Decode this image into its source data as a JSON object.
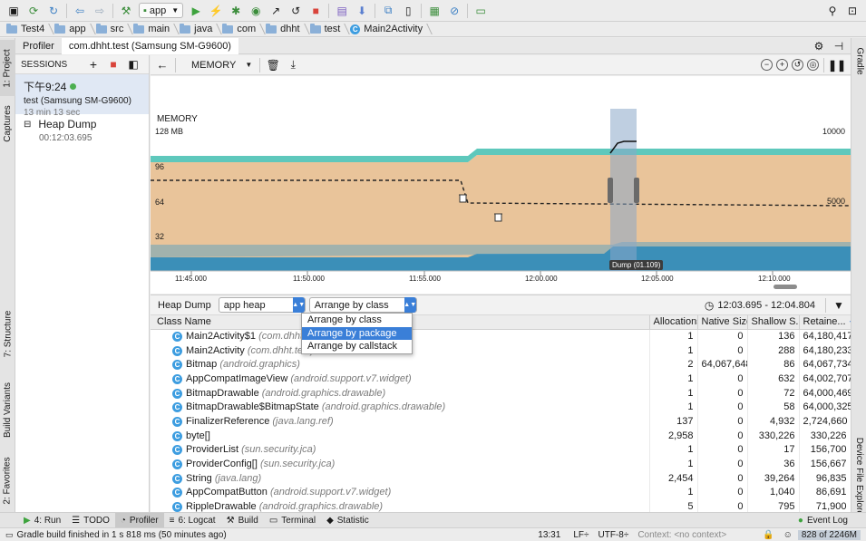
{
  "toolbar": {
    "run_config": "app",
    "icons": [
      "save-icon",
      "sync-icon",
      "refresh-icon",
      "back-icon",
      "forward-icon",
      "build-hammer-icon",
      "run-icon",
      "debug-icon",
      "profile-icon",
      "attach-icon",
      "stop-icon",
      "sdk-icon",
      "download-icon",
      "structure-icon",
      "device-icon",
      "layout-icon",
      "search-icon",
      "user-icon"
    ]
  },
  "breadcrumb": [
    "Test4",
    "app",
    "src",
    "main",
    "java",
    "com",
    "dhht",
    "test",
    "Main2Activity"
  ],
  "left_strip": {
    "project": "1: Project",
    "captures": "Captures",
    "structure": "7: Structure",
    "build_variants": "Build Variants",
    "favorites": "2: Favorites"
  },
  "right_strip": {
    "gradle": "Gradle",
    "device_file_explorer": "Device File Explorer"
  },
  "profiler_header": {
    "tab1": "Profiler",
    "tab2": "com.dhht.test (Samsung SM-G9600)"
  },
  "sessions": {
    "title": "SESSIONS",
    "session_time": "下午9:24",
    "session_device": "test (Samsung SM-G9600)",
    "session_duration": "13 min 13 sec",
    "heap_dump_label": "Heap Dump",
    "heap_dump_time": "00:12:03.695"
  },
  "memory": {
    "selector": "MEMORY",
    "chart_title": "MEMORY",
    "top_label": "128 MB",
    "y_ticks": [
      "96",
      "64",
      "32"
    ],
    "right_ticks": [
      "10000",
      "5000"
    ],
    "x_ticks": [
      "11:45.000",
      "11:50.000",
      "11:55.000",
      "12:00.000",
      "12:05.000",
      "12:10.000"
    ],
    "dump_tooltip": "Dump (01.109)"
  },
  "heap_toolbar": {
    "label": "Heap Dump",
    "heap_select": "app heap",
    "arrange_select": "Arrange by class",
    "range": "12:03.695 - 12:04.804"
  },
  "dropdown_options": [
    "Arrange by class",
    "Arrange by package",
    "Arrange by callstack"
  ],
  "table": {
    "headers": [
      "Class Name",
      "Allocations",
      "Native Size",
      "Shallow S...",
      "Retaine..."
    ],
    "rows": [
      {
        "name": "Main2Activity$1",
        "pkg": "(com.dhht.test)",
        "alloc": "1",
        "native": "0",
        "shallow": "136",
        "retained": "64,180,417"
      },
      {
        "name": "Main2Activity",
        "pkg": "(com.dhht.test)",
        "alloc": "1",
        "native": "0",
        "shallow": "288",
        "retained": "64,180,233"
      },
      {
        "name": "Bitmap",
        "pkg": "(android.graphics)",
        "alloc": "2",
        "native": "64,067,648",
        "shallow": "86",
        "retained": "64,067,734"
      },
      {
        "name": "AppCompatImageView",
        "pkg": "(android.support.v7.widget)",
        "alloc": "1",
        "native": "0",
        "shallow": "632",
        "retained": "64,002,707"
      },
      {
        "name": "BitmapDrawable",
        "pkg": "(android.graphics.drawable)",
        "alloc": "1",
        "native": "0",
        "shallow": "72",
        "retained": "64,000,469"
      },
      {
        "name": "BitmapDrawable$BitmapState",
        "pkg": "(android.graphics.drawable)",
        "alloc": "1",
        "native": "0",
        "shallow": "58",
        "retained": "64,000,325"
      },
      {
        "name": "FinalizerReference",
        "pkg": "(java.lang.ref)",
        "alloc": "137",
        "native": "0",
        "shallow": "4,932",
        "retained": "2,724,660"
      },
      {
        "name": "byte[]",
        "pkg": "",
        "alloc": "2,958",
        "native": "0",
        "shallow": "330,226",
        "retained": "330,226"
      },
      {
        "name": "ProviderList",
        "pkg": "(sun.security.jca)",
        "alloc": "1",
        "native": "0",
        "shallow": "17",
        "retained": "156,700"
      },
      {
        "name": "ProviderConfig[]",
        "pkg": "(sun.security.jca)",
        "alloc": "1",
        "native": "0",
        "shallow": "36",
        "retained": "156,667"
      },
      {
        "name": "String",
        "pkg": "(java.lang)",
        "alloc": "2,454",
        "native": "0",
        "shallow": "39,264",
        "retained": "96,835"
      },
      {
        "name": "AppCompatButton",
        "pkg": "(android.support.v7.widget)",
        "alloc": "1",
        "native": "0",
        "shallow": "1,040",
        "retained": "86,691"
      },
      {
        "name": "RippleDrawable",
        "pkg": "(android.graphics.drawable)",
        "alloc": "5",
        "native": "0",
        "shallow": "795",
        "retained": "71,900"
      }
    ]
  },
  "bottom_tabs": [
    {
      "label": "4: Run",
      "icon": "run-icon"
    },
    {
      "label": "TODO",
      "icon": "todo-icon"
    },
    {
      "label": "Profiler",
      "icon": "profiler-icon"
    },
    {
      "label": "6: Logcat",
      "icon": "logcat-icon"
    },
    {
      "label": "Build",
      "icon": "build-icon"
    },
    {
      "label": "Terminal",
      "icon": "terminal-icon"
    },
    {
      "label": "Statistic",
      "icon": "statistic-icon"
    }
  ],
  "event_log": "Event Log",
  "status": {
    "message": "Gradle build finished in 1 s 818 ms (50 minutes ago)",
    "position": "13:31",
    "line_sep": "LF÷",
    "encoding": "UTF-8÷",
    "context": "Context: <no context>",
    "memory": "828 of 2246M"
  },
  "colors": {
    "accent": "#3a7fd8",
    "java_heap": "#e9c49a",
    "teal": "#5ec8bc",
    "native": "#3b8fb8",
    "selection": "#8aa8c8"
  }
}
